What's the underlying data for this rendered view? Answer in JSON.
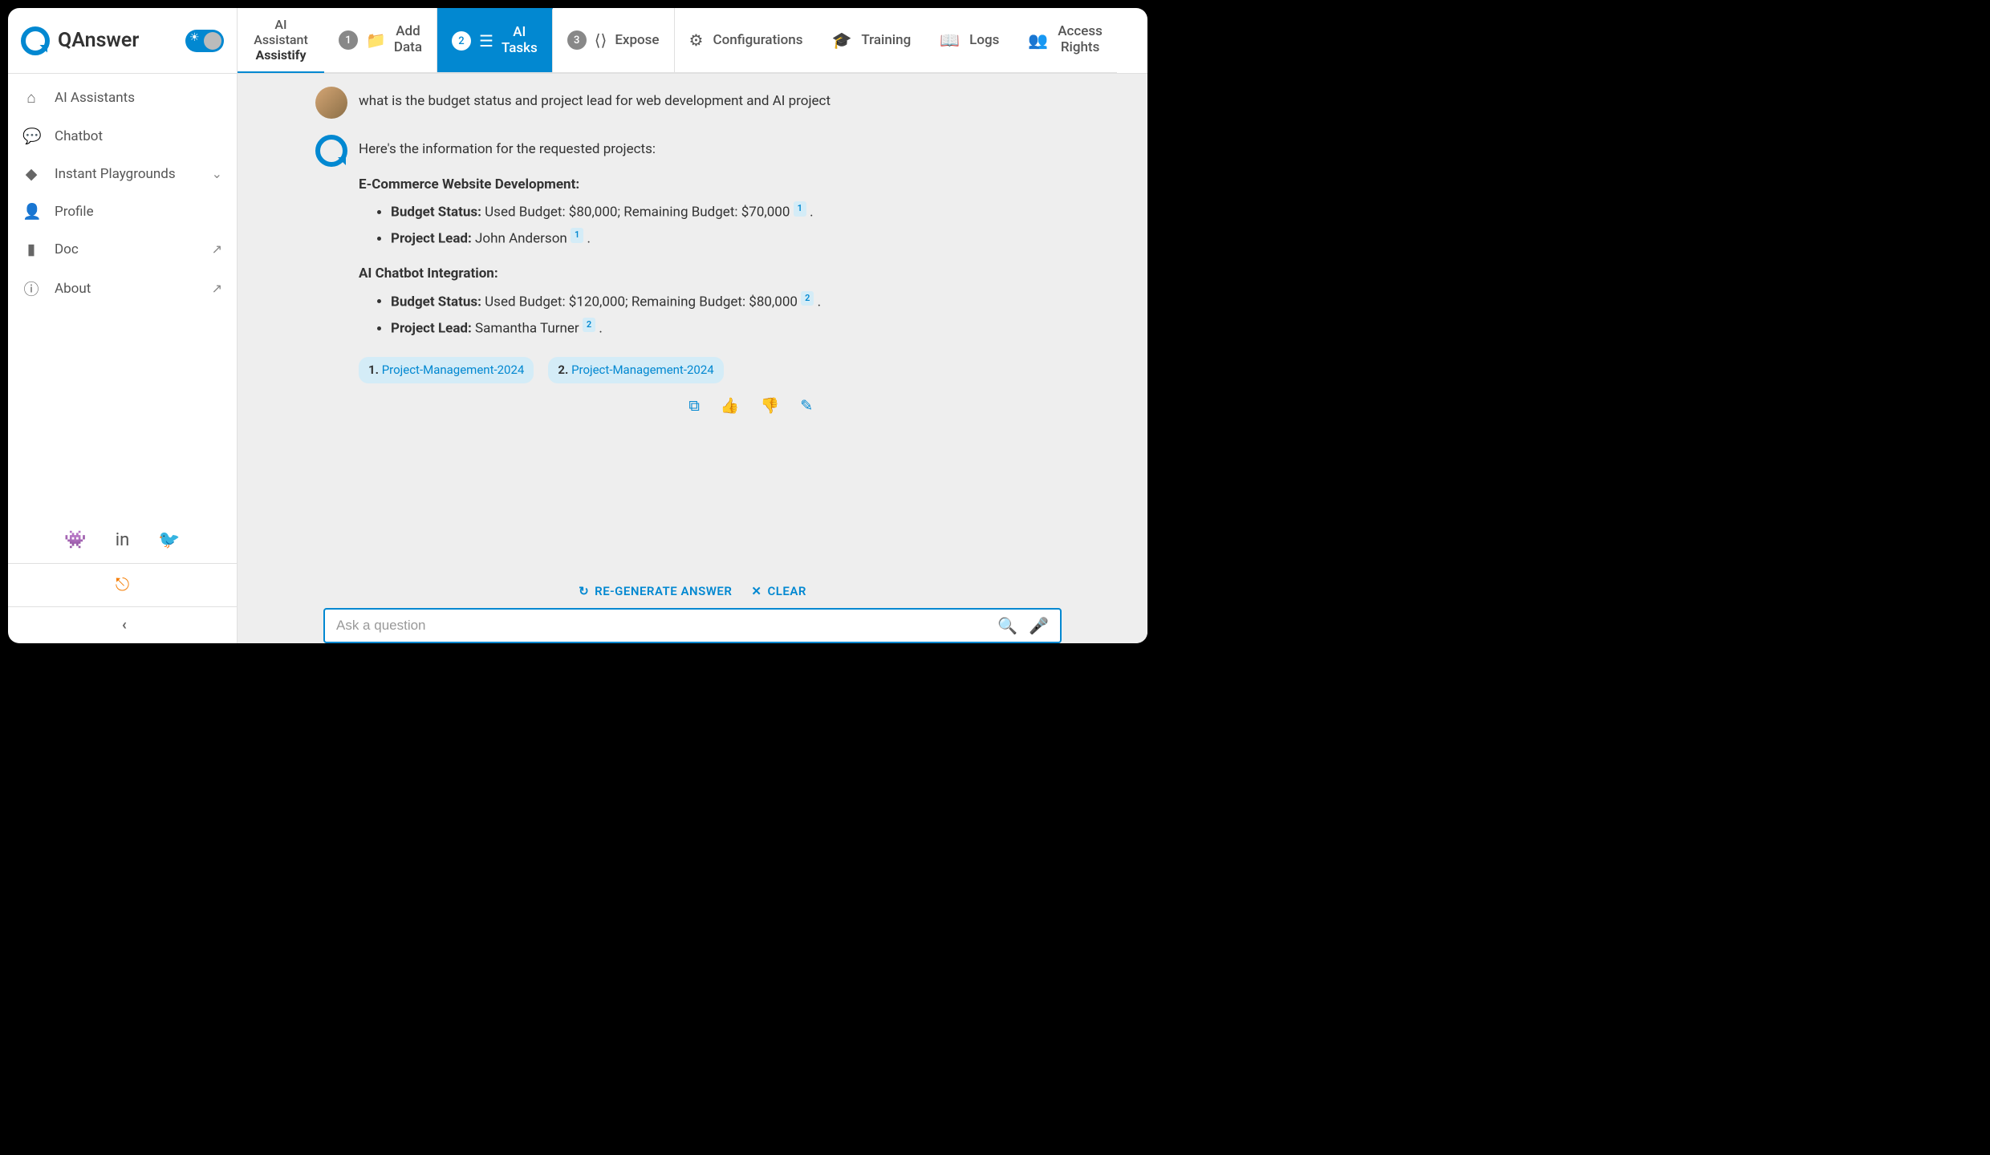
{
  "brand": "QAnswer",
  "assistant": {
    "line1": "AI",
    "line2": "Assistant",
    "line3": "Assistify"
  },
  "topnav": {
    "steps": [
      {
        "num": "1",
        "label_l1": "Add",
        "label_l2": "Data"
      },
      {
        "num": "2",
        "label_l1": "AI",
        "label_l2": "Tasks"
      },
      {
        "num": "3",
        "label_l1": "Expose",
        "label_l2": ""
      }
    ],
    "items": [
      {
        "label": "Configurations"
      },
      {
        "label": "Training"
      },
      {
        "label": "Logs"
      },
      {
        "label_l1": "Access",
        "label_l2": "Rights"
      }
    ]
  },
  "sidebar": {
    "items": [
      {
        "icon": "home-icon",
        "label": "AI Assistants"
      },
      {
        "icon": "chat-icon",
        "label": "Chatbot"
      },
      {
        "icon": "shapes-icon",
        "label": "Instant Playgrounds",
        "chevron": true
      },
      {
        "icon": "profile-icon",
        "label": "Profile"
      },
      {
        "icon": "doc-icon",
        "label": "Doc",
        "external": true
      },
      {
        "icon": "info-icon",
        "label": "About",
        "external": true
      }
    ]
  },
  "conversation": {
    "user_question": "what is the budget status and project lead for web development and AI project",
    "answer_intro": "Here's the information for the requested projects:",
    "projects": [
      {
        "title": "E-Commerce Website Development:",
        "budget_label": "Budget Status:",
        "budget_text": "Used Budget: $80,000; Remaining Budget: $70,000",
        "budget_cite": "1",
        "lead_label": "Project Lead:",
        "lead_text": "John Anderson",
        "lead_cite": "1"
      },
      {
        "title": "AI Chatbot Integration:",
        "budget_label": "Budget Status:",
        "budget_text": "Used Budget: $120,000; Remaining Budget: $80,000",
        "budget_cite": "2",
        "lead_label": "Project Lead:",
        "lead_text": "Samantha Turner",
        "lead_cite": "2"
      }
    ],
    "sources": [
      {
        "num": "1.",
        "name": "Project-Management-2024"
      },
      {
        "num": "2.",
        "name": "Project-Management-2024"
      }
    ]
  },
  "footer": {
    "regenerate": "RE-GENERATE ANSWER",
    "clear": "CLEAR",
    "placeholder": "Ask a question"
  }
}
